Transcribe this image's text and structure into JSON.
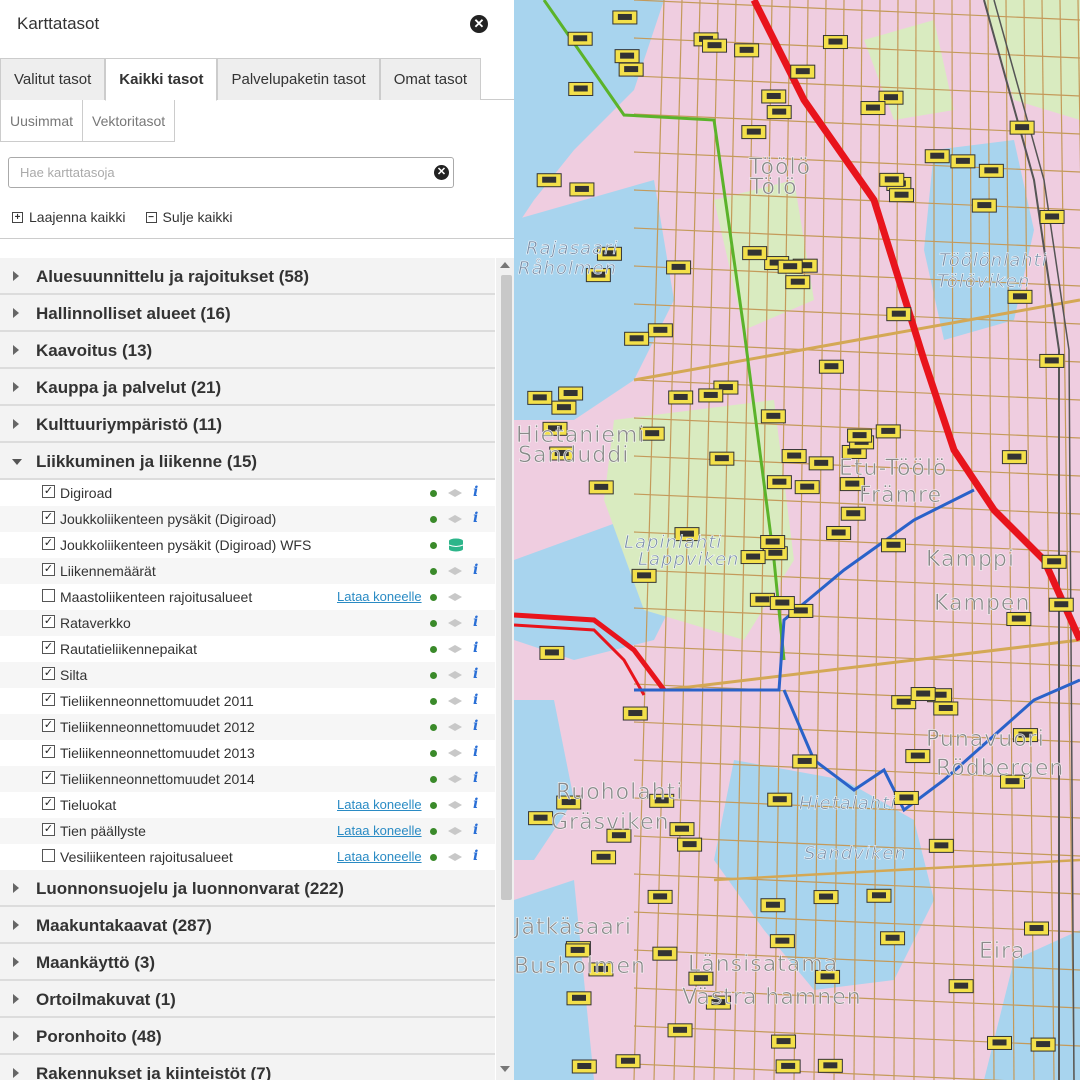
{
  "panel": {
    "title": "Karttatasot",
    "close_icon": "close-icon"
  },
  "tabs": [
    {
      "label": "Valitut tasot",
      "active": false
    },
    {
      "label": "Kaikki tasot",
      "active": true
    },
    {
      "label": "Palvelupaketin tasot",
      "active": false
    },
    {
      "label": "Omat tasot",
      "active": false
    }
  ],
  "subtabs": [
    {
      "label": "Uusimmat"
    },
    {
      "label": "Vektoritasot"
    }
  ],
  "search": {
    "placeholder": "Hae karttatasoja",
    "value": ""
  },
  "controls": {
    "expand_all": "Laajenna kaikki",
    "collapse_all": "Sulje kaikki"
  },
  "groups_before": [
    {
      "label": "Aluesuunnittelu ja rajoitukset (58)"
    },
    {
      "label": "Hallinnolliset alueet (16)"
    },
    {
      "label": "Kaavoitus (13)"
    },
    {
      "label": "Kauppa ja palvelut (21)"
    },
    {
      "label": "Kulttuuriympäristö (11)"
    }
  ],
  "open_group": {
    "label": "Liikkuminen ja liikenne (15)",
    "layers": [
      {
        "name": "Digiroad",
        "checked": true,
        "download": "",
        "info": true,
        "db": false
      },
      {
        "name": "Joukkoliikenteen pysäkit (Digiroad)",
        "checked": true,
        "download": "",
        "info": true,
        "db": false
      },
      {
        "name": "Joukkoliikenteen pysäkit (Digiroad) WFS",
        "checked": true,
        "download": "",
        "info": false,
        "db": true
      },
      {
        "name": "Liikennemäärät",
        "checked": true,
        "download": "",
        "info": true,
        "db": false
      },
      {
        "name": "Maastoliikenteen rajoitusalueet",
        "checked": false,
        "download": "Lataa koneelle",
        "info": false,
        "db": false
      },
      {
        "name": "Rataverkko",
        "checked": true,
        "download": "",
        "info": true,
        "db": false
      },
      {
        "name": "Rautatieliikennepaikat",
        "checked": true,
        "download": "",
        "info": true,
        "db": false
      },
      {
        "name": "Silta",
        "checked": true,
        "download": "",
        "info": true,
        "db": false
      },
      {
        "name": "Tieliikenneonnettomuudet 2011",
        "checked": true,
        "download": "",
        "info": true,
        "db": false
      },
      {
        "name": "Tieliikenneonnettomuudet 2012",
        "checked": true,
        "download": "",
        "info": true,
        "db": false
      },
      {
        "name": "Tieliikenneonnettomuudet 2013",
        "checked": true,
        "download": "",
        "info": true,
        "db": false
      },
      {
        "name": "Tieliikenneonnettomuudet 2014",
        "checked": true,
        "download": "",
        "info": true,
        "db": false
      },
      {
        "name": "Tieluokat",
        "checked": true,
        "download": "Lataa koneelle",
        "info": true,
        "db": false
      },
      {
        "name": "Tien päällyste",
        "checked": true,
        "download": "Lataa koneelle",
        "info": true,
        "db": false
      },
      {
        "name": "Vesiliikenteen rajoitusalueet",
        "checked": false,
        "download": "Lataa koneelle",
        "info": true,
        "db": false
      }
    ]
  },
  "groups_after": [
    {
      "label": "Luonnonsuojelu ja luonnonvarat (222)"
    },
    {
      "label": "Maakuntakaavat (287)"
    },
    {
      "label": "Maankäyttö (3)"
    },
    {
      "label": "Ortoilmakuvat (1)"
    },
    {
      "label": "Poronhoito (48)"
    },
    {
      "label": "Rakennukset ja kiinteistöt (7)"
    }
  ],
  "map": {
    "labels": [
      {
        "text": "Rajasaari",
        "style": "small"
      },
      {
        "text": "Råholmen",
        "style": "small"
      },
      {
        "text": "Töölönlahti",
        "style": "small"
      },
      {
        "text": "Tölöviken",
        "style": "small"
      },
      {
        "text": "Hietaniemi",
        "style": "normal"
      },
      {
        "text": "Sanduddi",
        "style": "normal"
      },
      {
        "text": "Etu-Töölö",
        "style": "normal"
      },
      {
        "text": "Främre",
        "style": "normal"
      },
      {
        "text": "Lapinlahti",
        "style": "small"
      },
      {
        "text": "Lappviken",
        "style": "small"
      },
      {
        "text": "Kamppi",
        "style": "normal"
      },
      {
        "text": "Kampen",
        "style": "normal"
      },
      {
        "text": "Punavuori",
        "style": "normal"
      },
      {
        "text": "Rödbergen",
        "style": "normal"
      },
      {
        "text": "Ruoholahti",
        "style": "normal"
      },
      {
        "text": "Gräsviken",
        "style": "normal"
      },
      {
        "text": "Hietalahti",
        "style": "small"
      },
      {
        "text": "Sandviken",
        "style": "small"
      },
      {
        "text": "Jätkäsaari",
        "style": "normal"
      },
      {
        "text": "Busholmen",
        "style": "normal"
      },
      {
        "text": "Länsisatama",
        "style": "normal"
      },
      {
        "text": "Västra hamnen",
        "style": "normal"
      },
      {
        "text": "Eira",
        "style": "normal"
      },
      {
        "text": "Töölö",
        "style": "normal"
      },
      {
        "text": "Tölö",
        "style": "normal"
      }
    ],
    "colors": {
      "water": "#a8d4ee",
      "urban": "#efcde0",
      "park": "#d9ebc0",
      "metro": "#e8141c",
      "tram": "#2a62c9",
      "rail_green": "#5bb32a",
      "road": "#b88a4a",
      "bus_icon": "#f3e04a"
    }
  }
}
